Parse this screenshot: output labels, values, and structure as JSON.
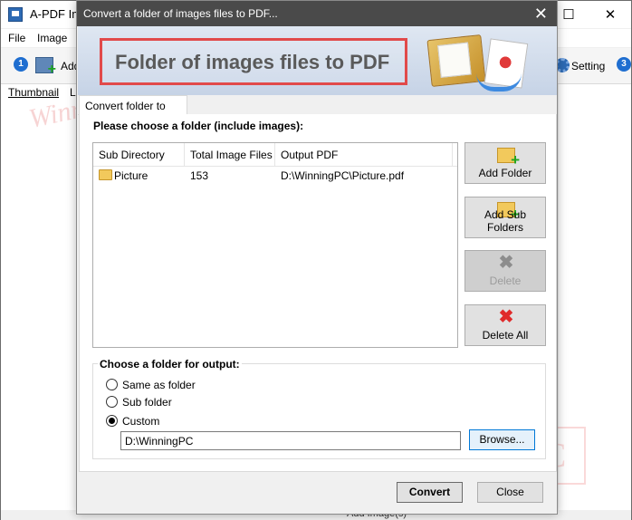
{
  "app": {
    "title": "A-PDF Ima",
    "menu": [
      "File",
      "Image"
    ],
    "toolbar": {
      "step1": "1",
      "add_label": "Add",
      "setting_label": "Setting",
      "step3": "3"
    },
    "left_tabs": [
      "Thumbnail",
      "Li"
    ],
    "status": "Add Image(s)",
    "window_buttons": [
      "—",
      "☐",
      "✕"
    ]
  },
  "dialog": {
    "title": "Convert a folder of images files to PDF...",
    "close_symbol": "✕",
    "banner_text": "Folder of images files to PDF",
    "tab": "Convert folder to PDF",
    "choose_label": "Please choose a folder (include images):",
    "columns": [
      "Sub Directory",
      "Total Image Files",
      "Output PDF"
    ],
    "rows": [
      {
        "sub": "Picture",
        "total": "153",
        "output": "D:\\WinningPC\\Picture.pdf"
      }
    ],
    "buttons": {
      "add_folder": "Add Folder",
      "add_sub_folders": "Add Sub Folders",
      "delete": "Delete",
      "delete_all": "Delete All"
    },
    "output_label": "Choose a folder for output:",
    "options": [
      "Same as folder",
      "Sub folder",
      "Custom"
    ],
    "selected_option": "Custom",
    "custom_path": "D:\\WinningPC",
    "browse": "Browse...",
    "convert": "Convert",
    "close": "Close"
  }
}
